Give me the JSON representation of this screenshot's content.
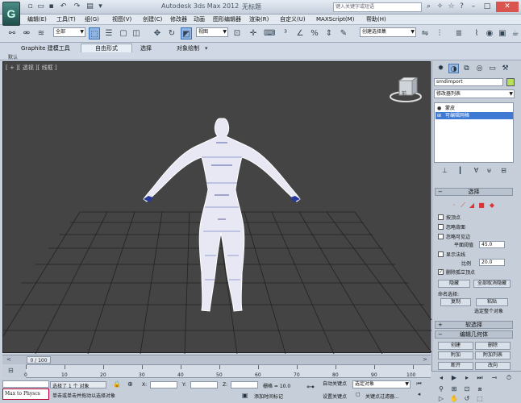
{
  "titlebar": {
    "app_title": "Autodesk 3ds Max  2012",
    "doc_title": "无标题",
    "search_placeholder": "键入关键字或短语",
    "logo_letter": "G"
  },
  "menu": {
    "items": [
      "编辑(E)",
      "工具(T)",
      "组(G)",
      "视图(V)",
      "创建(C)",
      "修改器",
      "动画",
      "图形编辑器",
      "渲染(R)",
      "自定义(U)",
      "MAXScript(M)",
      "帮助(H)"
    ]
  },
  "toolbar": {
    "filter_value": "全部",
    "refcoord_value": "视图",
    "named_selection_value": "创建选择集"
  },
  "ribbon": {
    "tabs": [
      "Graphite 建模工具",
      "自由形式",
      "选择",
      "对象绘制"
    ],
    "default_label": "默认"
  },
  "viewport": {
    "label": "[ + ][ 透视 ][ 线框 ]",
    "viewcube_label": "前"
  },
  "command_panel": {
    "object_name": "smdimport",
    "modifier_list": "修改器列表",
    "stack_items": [
      "蒙皮",
      "可编辑网格"
    ],
    "selection_rollout": {
      "title": "选择",
      "options": [
        "按顶点",
        "忽略背面",
        "忽略可见边"
      ],
      "planar_threshold_label": "平面阈值",
      "planar_threshold_value": "45.0",
      "show_normals_label": "显示法线",
      "scale_label": "比例",
      "scale_value": "20.0",
      "delete_isolated_label": "删除孤立顶点",
      "hide_button": "隐藏",
      "unhide_all_button": "全部取消隐藏",
      "named_sel_label": "命名选择:",
      "copy_button": "复制",
      "paste_button": "粘贴",
      "select_whole_label": "选定整个对象"
    },
    "soft_selection_title": "软选择",
    "edit_geometry": {
      "title": "编辑几何体",
      "buttons": [
        "创建",
        "删除",
        "附加",
        "附加列表",
        "断开",
        "改向"
      ]
    }
  },
  "timeline": {
    "frame_counter": "0 / 100",
    "tick_labels": [
      "0",
      "10",
      "20",
      "30",
      "40",
      "50",
      "60",
      "70",
      "80",
      "90",
      "100"
    ]
  },
  "status": {
    "script_listener": "Max to Physcs",
    "selection_text": "选择了 1 个 对象",
    "prompt_text": "单击或单击并拖动以选择对象",
    "x_label": "X:",
    "y_label": "Y:",
    "z_label": "Z:",
    "grid_text": "栅格 = 10.0",
    "add_time_tag": "添加时间标记",
    "autokey_label": "自动关键点",
    "selection_set_value": "选定对象",
    "set_key_label": "设置关键点",
    "key_filters": "关键点过滤器..."
  }
}
